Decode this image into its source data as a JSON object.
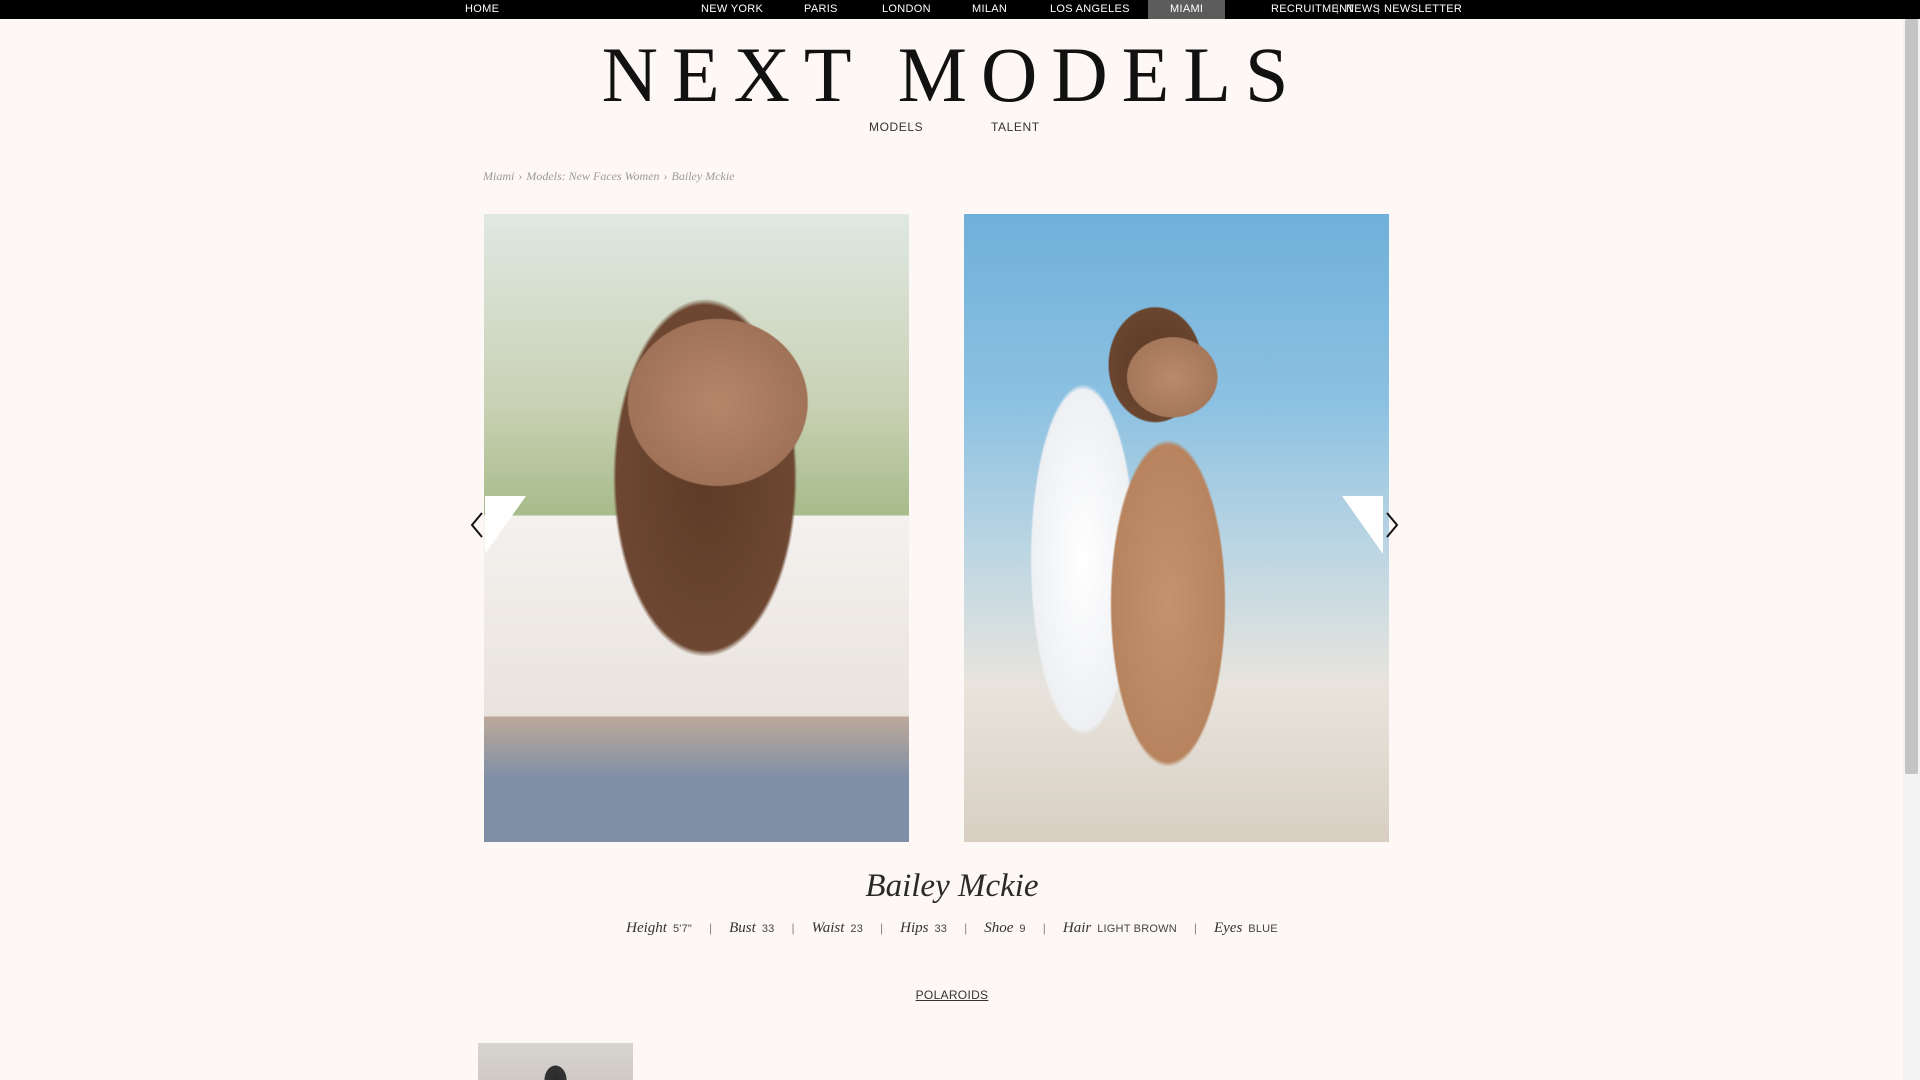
{
  "topbar": {
    "home": "HOME",
    "cities": [
      "NEW YORK",
      "PARIS",
      "LONDON",
      "MILAN",
      "LOS ANGELES",
      "MIAMI"
    ],
    "active_city": "MIAMI",
    "right_links": [
      "RECRUITMENT",
      "NEWS",
      "NEWSLETTER"
    ],
    "separator": "|"
  },
  "logo": "NEXT MODELS",
  "subnav": [
    "MODELS",
    "TALENT"
  ],
  "breadcrumb": [
    "Miami",
    "Models: New Faces Women",
    "Bailey Mckie"
  ],
  "breadcrumb_separator": "›",
  "model": {
    "name": "Bailey Mckie",
    "stats": [
      {
        "label": "Height",
        "value": "5'7\""
      },
      {
        "label": "Bust",
        "value": "33"
      },
      {
        "label": "Waist",
        "value": "23"
      },
      {
        "label": "Hips",
        "value": "33"
      },
      {
        "label": "Shoe",
        "value": "9"
      },
      {
        "label": "Hair",
        "value": "LIGHT BROWN"
      },
      {
        "label": "Eyes",
        "value": "BLUE"
      }
    ],
    "stat_separator": "|"
  },
  "polaroids_link": "POLAROIDS",
  "icons": {
    "prev": "chevron-left-icon",
    "next": "chevron-right-icon"
  },
  "colors": {
    "background": "#fdf8f5",
    "topbar": "#000000",
    "active_tab": "#5c5c5c",
    "breadcrumb": "#9a9a9a"
  }
}
